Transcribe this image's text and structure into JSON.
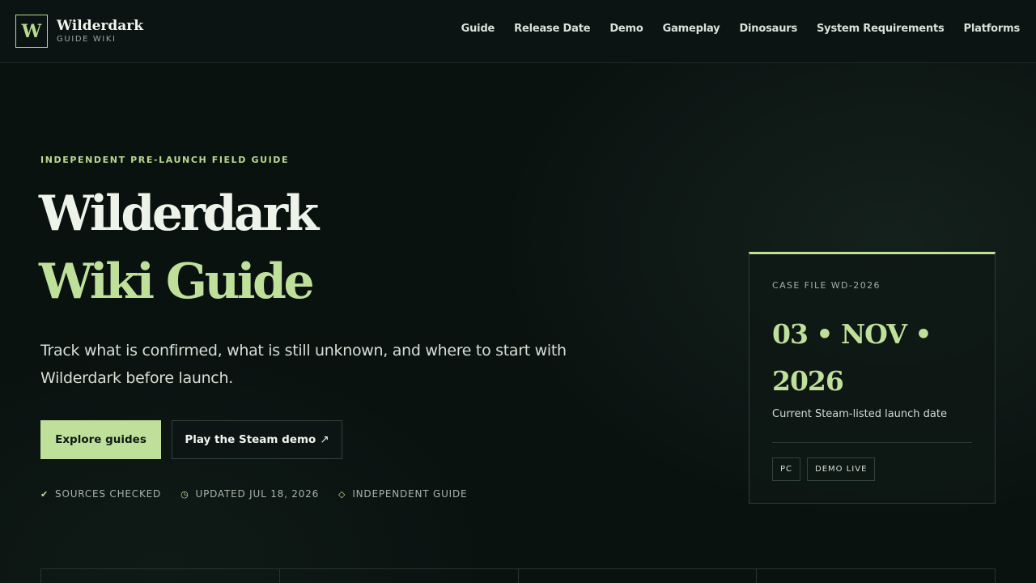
{
  "header": {
    "logo_letter": "W",
    "logo_name": "Wilderdark",
    "logo_sub": "GUIDE WIKI",
    "nav": [
      {
        "label": "Guide"
      },
      {
        "label": "Release Date"
      },
      {
        "label": "Demo"
      },
      {
        "label": "Gameplay"
      },
      {
        "label": "Dinosaurs"
      },
      {
        "label": "System Requirements"
      },
      {
        "label": "Platforms"
      }
    ]
  },
  "hero": {
    "eyebrow": "INDEPENDENT PRE-LAUNCH FIELD GUIDE",
    "title_line1": "Wilderdark",
    "title_line2": "Wiki Guide",
    "lede": "Track what is confirmed, what is still unknown, and where to start with Wilderdark before launch.",
    "primary_button": "Explore guides",
    "secondary_button": "Play the Steam demo",
    "secondary_button_icon": "external-arrow-icon",
    "meta": [
      {
        "icon": "check-icon",
        "glyph": "✔",
        "label": "SOURCES CHECKED"
      },
      {
        "icon": "clock-icon",
        "glyph": "◷",
        "label": "UPDATED JUL 18, 2026"
      },
      {
        "icon": "diamond-icon",
        "glyph": "◇",
        "label": "INDEPENDENT GUIDE"
      }
    ]
  },
  "case_file": {
    "label": "CASE FILE WD-2026",
    "date": "03 • NOV • 2026",
    "caption": "Current Steam-listed launch date",
    "tags": [
      "PC",
      "DEMO LIVE"
    ]
  },
  "colors": {
    "background": "#0a1210",
    "accent": "#bfe09a",
    "text": "#e8efe6"
  }
}
